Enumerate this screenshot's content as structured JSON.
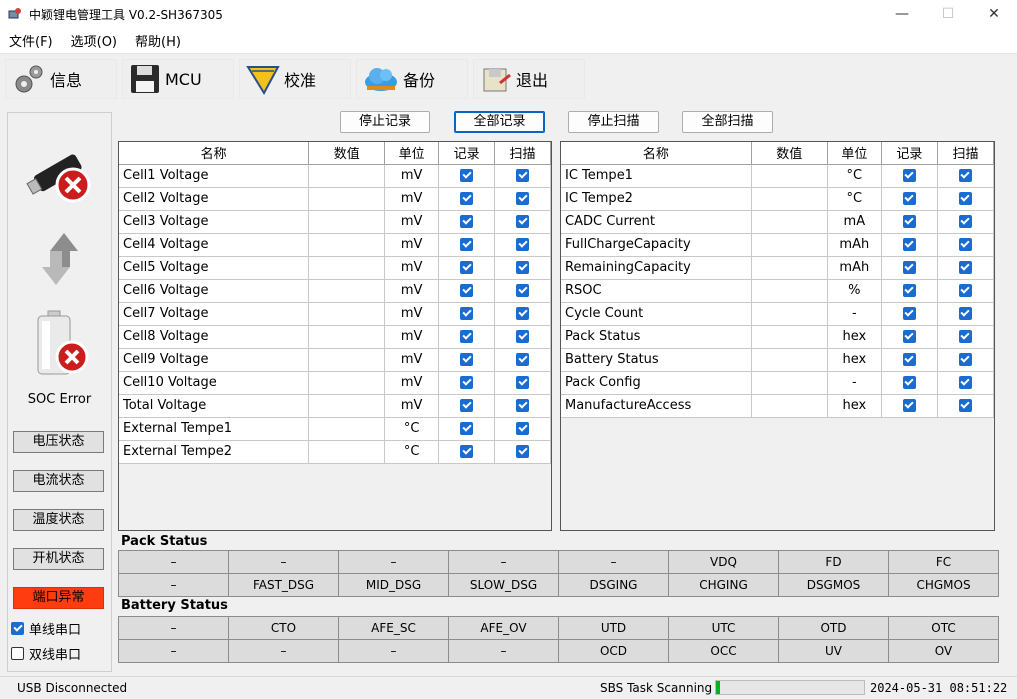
{
  "window": {
    "title": "中颖锂电管理工具 V0.2-SH367305",
    "minimize": "—",
    "maximize": "☐",
    "close": "✕"
  },
  "menu": [
    "文件(F)",
    "选项(O)",
    "帮助(H)"
  ],
  "toolbar": {
    "info": "信息",
    "mcu": "MCU",
    "calibrate": "校准",
    "backup": "备份",
    "exit": "退出"
  },
  "buttons": {
    "stop_record": "停止记录",
    "all_record": "全部记录",
    "stop_scan": "停止扫描",
    "all_scan": "全部扫描"
  },
  "left_panel": {
    "soc_text": "SOC Error",
    "voltage_status": "电压状态",
    "current_status": "电流状态",
    "temp_status": "温度状态",
    "power_status": "开机状态",
    "port_error": "端口异常",
    "single_serial": "单线串口",
    "dual_serial": "双线串口",
    "single_checked": true,
    "dual_checked": false,
    "error_color": "#ff3c10"
  },
  "table_headers": {
    "name": "名称",
    "value": "数值",
    "unit": "单位",
    "record": "记录",
    "scan": "扫描"
  },
  "left_table": [
    {
      "name": "Cell1 Voltage",
      "value": "",
      "unit": "mV"
    },
    {
      "name": "Cell2 Voltage",
      "value": "",
      "unit": "mV"
    },
    {
      "name": "Cell3 Voltage",
      "value": "",
      "unit": "mV"
    },
    {
      "name": "Cell4 Voltage",
      "value": "",
      "unit": "mV"
    },
    {
      "name": "Cell5 Voltage",
      "value": "",
      "unit": "mV"
    },
    {
      "name": "Cell6 Voltage",
      "value": "",
      "unit": "mV"
    },
    {
      "name": "Cell7 Voltage",
      "value": "",
      "unit": "mV"
    },
    {
      "name": "Cell8 Voltage",
      "value": "",
      "unit": "mV"
    },
    {
      "name": "Cell9 Voltage",
      "value": "",
      "unit": "mV"
    },
    {
      "name": "Cell10 Voltage",
      "value": "",
      "unit": "mV"
    },
    {
      "name": "Total Voltage",
      "value": "",
      "unit": "mV"
    },
    {
      "name": "External Tempe1",
      "value": "",
      "unit": "°C"
    },
    {
      "name": "External Tempe2",
      "value": "",
      "unit": "°C"
    }
  ],
  "right_table": [
    {
      "name": "IC Tempe1",
      "value": "",
      "unit": "°C"
    },
    {
      "name": "IC Tempe2",
      "value": "",
      "unit": "°C"
    },
    {
      "name": "CADC Current",
      "value": "",
      "unit": "mA"
    },
    {
      "name": "FullChargeCapacity",
      "value": "",
      "unit": "mAh"
    },
    {
      "name": "RemainingCapacity",
      "value": "",
      "unit": "mAh"
    },
    {
      "name": "RSOC",
      "value": "",
      "unit": "%"
    },
    {
      "name": "Cycle Count",
      "value": "",
      "unit": "-"
    },
    {
      "name": "Pack Status",
      "value": "",
      "unit": "hex"
    },
    {
      "name": "Battery Status",
      "value": "",
      "unit": "hex"
    },
    {
      "name": "Pack Config",
      "value": "",
      "unit": "-"
    },
    {
      "name": "ManufactureAccess",
      "value": "",
      "unit": "hex"
    }
  ],
  "pack_status": {
    "label": "Pack Status",
    "rows": [
      [
        "–",
        "–",
        "–",
        "–",
        "–",
        "VDQ",
        "FD",
        "FC"
      ],
      [
        "–",
        "FAST_DSG",
        "MID_DSG",
        "SLOW_DSG",
        "DSGING",
        "CHGING",
        "DSGMOS",
        "CHGMOS"
      ]
    ]
  },
  "battery_status": {
    "label": "Battery Status",
    "rows": [
      [
        "–",
        "CTO",
        "AFE_SC",
        "AFE_OV",
        "UTD",
        "UTC",
        "OTD",
        "OTC"
      ],
      [
        "–",
        "–",
        "–",
        "–",
        "OCD",
        "OCC",
        "UV",
        "OV"
      ]
    ]
  },
  "statusbar": {
    "left": "USB Disconnected",
    "task": "SBS Task Scanning",
    "progress": 0.03,
    "time": "2024-05-31 08:51:22"
  }
}
